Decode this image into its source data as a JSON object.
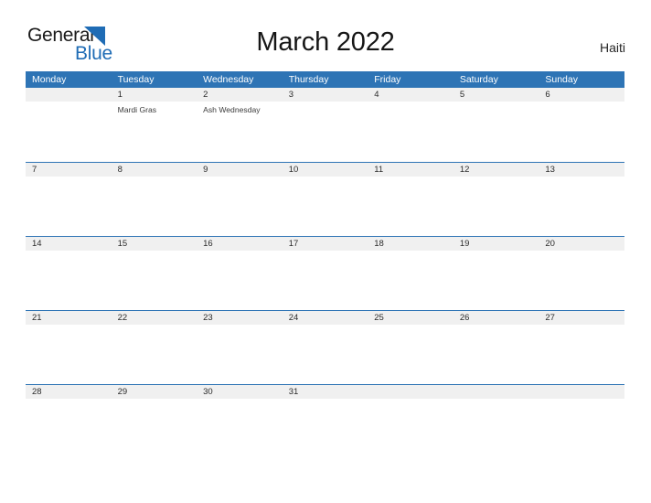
{
  "header": {
    "logo": {
      "word_one": "General",
      "word_two": "Blue",
      "triangle_icon": "blue-triangle-icon",
      "brand_color": "#1f6cb5"
    },
    "title": "March 2022",
    "country": "Haiti"
  },
  "calendar": {
    "month": "March",
    "year": "2022",
    "accent_color": "#2e74b5",
    "date_band_color": "#f0f0f0",
    "weekdays": [
      "Monday",
      "Tuesday",
      "Wednesday",
      "Thursday",
      "Friday",
      "Saturday",
      "Sunday"
    ],
    "weeks": [
      {
        "days": [
          {
            "date": "",
            "events": []
          },
          {
            "date": "1",
            "events": [
              "Mardi Gras"
            ]
          },
          {
            "date": "2",
            "events": [
              "Ash Wednesday"
            ]
          },
          {
            "date": "3",
            "events": []
          },
          {
            "date": "4",
            "events": []
          },
          {
            "date": "5",
            "events": []
          },
          {
            "date": "6",
            "events": []
          }
        ]
      },
      {
        "days": [
          {
            "date": "7",
            "events": []
          },
          {
            "date": "8",
            "events": []
          },
          {
            "date": "9",
            "events": []
          },
          {
            "date": "10",
            "events": []
          },
          {
            "date": "11",
            "events": []
          },
          {
            "date": "12",
            "events": []
          },
          {
            "date": "13",
            "events": []
          }
        ]
      },
      {
        "days": [
          {
            "date": "14",
            "events": []
          },
          {
            "date": "15",
            "events": []
          },
          {
            "date": "16",
            "events": []
          },
          {
            "date": "17",
            "events": []
          },
          {
            "date": "18",
            "events": []
          },
          {
            "date": "19",
            "events": []
          },
          {
            "date": "20",
            "events": []
          }
        ]
      },
      {
        "days": [
          {
            "date": "21",
            "events": []
          },
          {
            "date": "22",
            "events": []
          },
          {
            "date": "23",
            "events": []
          },
          {
            "date": "24",
            "events": []
          },
          {
            "date": "25",
            "events": []
          },
          {
            "date": "26",
            "events": []
          },
          {
            "date": "27",
            "events": []
          }
        ]
      },
      {
        "days": [
          {
            "date": "28",
            "events": []
          },
          {
            "date": "29",
            "events": []
          },
          {
            "date": "30",
            "events": []
          },
          {
            "date": "31",
            "events": []
          },
          {
            "date": "",
            "events": []
          },
          {
            "date": "",
            "events": []
          },
          {
            "date": "",
            "events": []
          }
        ]
      }
    ]
  }
}
